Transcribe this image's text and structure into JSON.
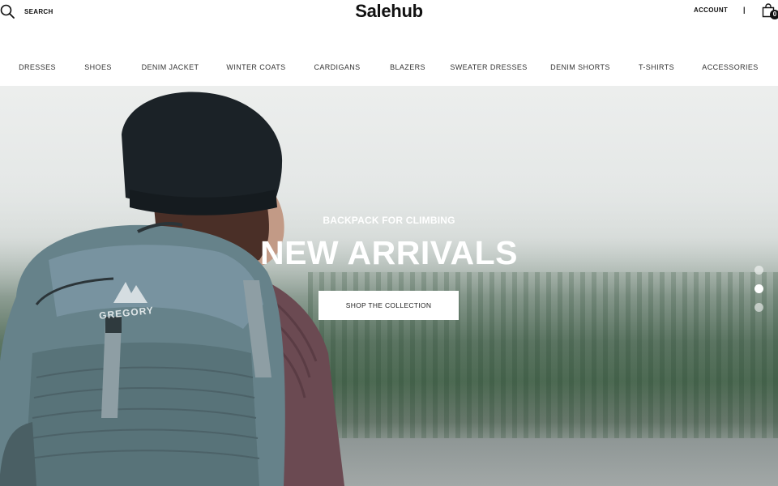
{
  "header": {
    "search_label": "SEARCH",
    "search_icon": "search-icon",
    "logo": "Salehub",
    "account_label": "ACCOUNT",
    "divider": "|",
    "cart_icon": "shopping-bag-icon",
    "cart_count": "0"
  },
  "nav": {
    "items": [
      {
        "label": "DRESSES"
      },
      {
        "label": "SHOES"
      },
      {
        "label": "DENIM JACKET"
      },
      {
        "label": "WINTER COATS"
      },
      {
        "label": "CARDIGANS"
      },
      {
        "label": "BLAZERS"
      },
      {
        "label": "SWEATER DRESSES"
      },
      {
        "label": "DENIM SHORTS"
      },
      {
        "label": "T-SHIRTS"
      },
      {
        "label": "ACCESSORIES"
      }
    ]
  },
  "hero": {
    "subtitle": "BACKPACK FOR CLIMBING",
    "title": "NEW ARRIVALS",
    "cta_label": "SHOP THE COLLECTION",
    "backpack_brand": "GREGORY",
    "slides": {
      "count": 3,
      "active_index": 1
    }
  },
  "colors": {
    "accent": "#111111",
    "cta_background": "#ffffff",
    "hero_text": "#ffffff"
  }
}
